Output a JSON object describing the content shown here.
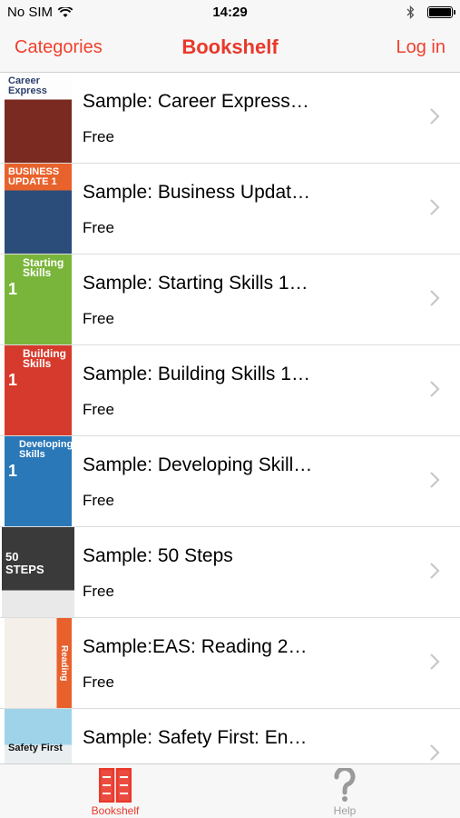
{
  "status_bar": {
    "carrier": "No SIM",
    "time": "14:29"
  },
  "nav": {
    "left_label": "Categories",
    "title": "Bookshelf",
    "right_label": "Log in"
  },
  "books": [
    {
      "title": "Sample: Career Express…",
      "price": "Free",
      "cover_text": "Career Express",
      "cover_color": "#c0392b"
    },
    {
      "title": "Sample: Business Updat…",
      "price": "Free",
      "cover_text": "BUSINESS UPDATE 1",
      "cover_color": "#2b4d7a"
    },
    {
      "title": "Sample: Starting Skills 1…",
      "price": "Free",
      "cover_text": "Starting Skills",
      "cover_color": "#7ab53b"
    },
    {
      "title": "Sample: Building Skills 1…",
      "price": "Free",
      "cover_text": "Building Skills",
      "cover_color": "#d63a2c"
    },
    {
      "title": "Sample: Developing Skill…",
      "price": "Free",
      "cover_text": "Developing Skills",
      "cover_color": "#2a78b8"
    },
    {
      "title": "Sample: 50 Steps",
      "price": "Free",
      "cover_text": "50 STEPS",
      "cover_color": "#3a3a3a"
    },
    {
      "title": "Sample:EAS: Reading 2…",
      "price": "Free",
      "cover_text": "Reading",
      "cover_color": "#e8602c"
    },
    {
      "title": "Sample: Safety First: En…",
      "price": "",
      "cover_text": "Safety First",
      "cover_color": "#4a9fc9"
    }
  ],
  "tabs": {
    "bookshelf_label": "Bookshelf",
    "help_label": "Help"
  },
  "colors": {
    "accent": "#e8392b"
  }
}
